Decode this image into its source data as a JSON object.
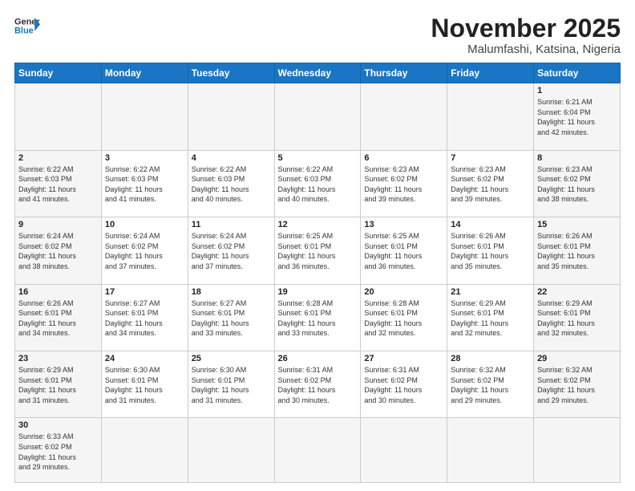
{
  "logo": {
    "text_general": "General",
    "text_blue": "Blue"
  },
  "header": {
    "title": "November 2025",
    "subtitle": "Malumfashi, Katsina, Nigeria"
  },
  "weekdays": [
    "Sunday",
    "Monday",
    "Tuesday",
    "Wednesday",
    "Thursday",
    "Friday",
    "Saturday"
  ],
  "days": [
    {
      "date": "",
      "info": ""
    },
    {
      "date": "",
      "info": ""
    },
    {
      "date": "",
      "info": ""
    },
    {
      "date": "",
      "info": ""
    },
    {
      "date": "",
      "info": ""
    },
    {
      "date": "",
      "info": ""
    },
    {
      "date": "1",
      "info": "Sunrise: 6:21 AM\nSunset: 6:04 PM\nDaylight: 11 hours\nand 42 minutes."
    },
    {
      "date": "2",
      "info": "Sunrise: 6:22 AM\nSunset: 6:03 PM\nDaylight: 11 hours\nand 41 minutes."
    },
    {
      "date": "3",
      "info": "Sunrise: 6:22 AM\nSunset: 6:03 PM\nDaylight: 11 hours\nand 41 minutes."
    },
    {
      "date": "4",
      "info": "Sunrise: 6:22 AM\nSunset: 6:03 PM\nDaylight: 11 hours\nand 40 minutes."
    },
    {
      "date": "5",
      "info": "Sunrise: 6:22 AM\nSunset: 6:03 PM\nDaylight: 11 hours\nand 40 minutes."
    },
    {
      "date": "6",
      "info": "Sunrise: 6:23 AM\nSunset: 6:02 PM\nDaylight: 11 hours\nand 39 minutes."
    },
    {
      "date": "7",
      "info": "Sunrise: 6:23 AM\nSunset: 6:02 PM\nDaylight: 11 hours\nand 39 minutes."
    },
    {
      "date": "8",
      "info": "Sunrise: 6:23 AM\nSunset: 6:02 PM\nDaylight: 11 hours\nand 38 minutes."
    },
    {
      "date": "9",
      "info": "Sunrise: 6:24 AM\nSunset: 6:02 PM\nDaylight: 11 hours\nand 38 minutes."
    },
    {
      "date": "10",
      "info": "Sunrise: 6:24 AM\nSunset: 6:02 PM\nDaylight: 11 hours\nand 37 minutes."
    },
    {
      "date": "11",
      "info": "Sunrise: 6:24 AM\nSunset: 6:02 PM\nDaylight: 11 hours\nand 37 minutes."
    },
    {
      "date": "12",
      "info": "Sunrise: 6:25 AM\nSunset: 6:01 PM\nDaylight: 11 hours\nand 36 minutes."
    },
    {
      "date": "13",
      "info": "Sunrise: 6:25 AM\nSunset: 6:01 PM\nDaylight: 11 hours\nand 36 minutes."
    },
    {
      "date": "14",
      "info": "Sunrise: 6:26 AM\nSunset: 6:01 PM\nDaylight: 11 hours\nand 35 minutes."
    },
    {
      "date": "15",
      "info": "Sunrise: 6:26 AM\nSunset: 6:01 PM\nDaylight: 11 hours\nand 35 minutes."
    },
    {
      "date": "16",
      "info": "Sunrise: 6:26 AM\nSunset: 6:01 PM\nDaylight: 11 hours\nand 34 minutes."
    },
    {
      "date": "17",
      "info": "Sunrise: 6:27 AM\nSunset: 6:01 PM\nDaylight: 11 hours\nand 34 minutes."
    },
    {
      "date": "18",
      "info": "Sunrise: 6:27 AM\nSunset: 6:01 PM\nDaylight: 11 hours\nand 33 minutes."
    },
    {
      "date": "19",
      "info": "Sunrise: 6:28 AM\nSunset: 6:01 PM\nDaylight: 11 hours\nand 33 minutes."
    },
    {
      "date": "20",
      "info": "Sunrise: 6:28 AM\nSunset: 6:01 PM\nDaylight: 11 hours\nand 32 minutes."
    },
    {
      "date": "21",
      "info": "Sunrise: 6:29 AM\nSunset: 6:01 PM\nDaylight: 11 hours\nand 32 minutes."
    },
    {
      "date": "22",
      "info": "Sunrise: 6:29 AM\nSunset: 6:01 PM\nDaylight: 11 hours\nand 32 minutes."
    },
    {
      "date": "23",
      "info": "Sunrise: 6:29 AM\nSunset: 6:01 PM\nDaylight: 11 hours\nand 31 minutes."
    },
    {
      "date": "24",
      "info": "Sunrise: 6:30 AM\nSunset: 6:01 PM\nDaylight: 11 hours\nand 31 minutes."
    },
    {
      "date": "25",
      "info": "Sunrise: 6:30 AM\nSunset: 6:01 PM\nDaylight: 11 hours\nand 31 minutes."
    },
    {
      "date": "26",
      "info": "Sunrise: 6:31 AM\nSunset: 6:02 PM\nDaylight: 11 hours\nand 30 minutes."
    },
    {
      "date": "27",
      "info": "Sunrise: 6:31 AM\nSunset: 6:02 PM\nDaylight: 11 hours\nand 30 minutes."
    },
    {
      "date": "28",
      "info": "Sunrise: 6:32 AM\nSunset: 6:02 PM\nDaylight: 11 hours\nand 29 minutes."
    },
    {
      "date": "29",
      "info": "Sunrise: 6:32 AM\nSunset: 6:02 PM\nDaylight: 11 hours\nand 29 minutes."
    },
    {
      "date": "30",
      "info": "Sunrise: 6:33 AM\nSunset: 6:02 PM\nDaylight: 11 hours\nand 29 minutes."
    }
  ]
}
